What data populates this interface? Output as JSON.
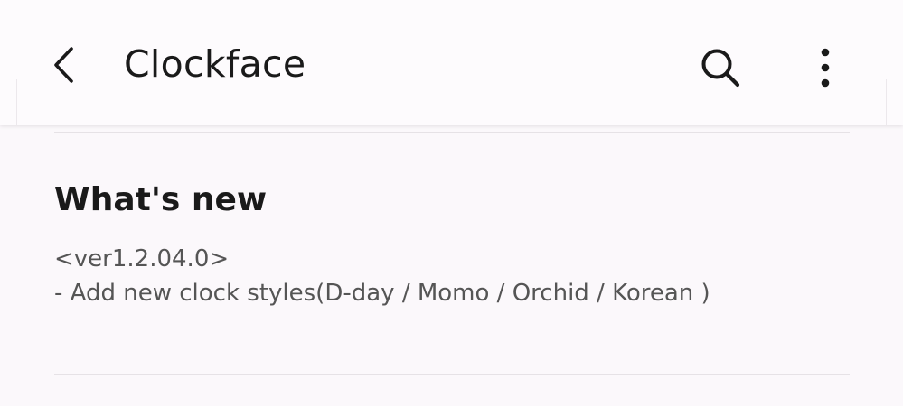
{
  "header": {
    "title": "Clockface",
    "back_icon": "chevron-left-icon",
    "search_icon": "search-icon",
    "more_icon": "more-vertical-icon"
  },
  "whats_new": {
    "title": "What's new",
    "version": "<ver1.2.04.0>",
    "changes": [
      "- Add new clock styles(D-day / Momo / Orchid / Korean )"
    ]
  },
  "colors": {
    "background": "#fdfbfd",
    "text_primary": "#1a1a1a",
    "text_secondary": "#555555",
    "divider": "#e6e2e6"
  }
}
